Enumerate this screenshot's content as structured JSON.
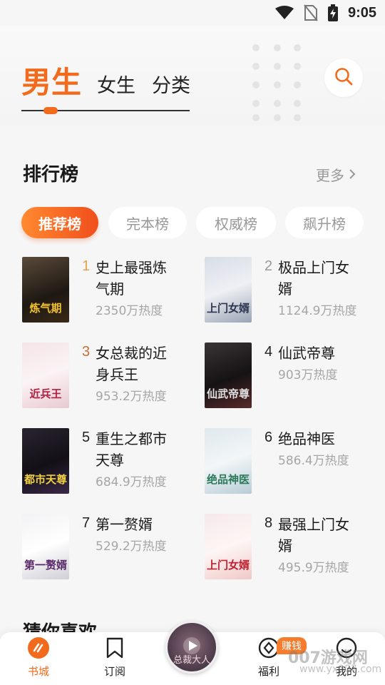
{
  "status_bar": {
    "time": "9:05",
    "icons": [
      "wifi-icon",
      "no-sim-icon",
      "battery-charging-icon"
    ]
  },
  "top_tabs": [
    {
      "label": "男生",
      "active": true
    },
    {
      "label": "女生",
      "active": false
    },
    {
      "label": "分类",
      "active": false
    }
  ],
  "search": {
    "icon": "search-icon"
  },
  "ranking": {
    "title": "排行榜",
    "more": "更多",
    "pills": [
      {
        "label": "推荐榜",
        "active": true
      },
      {
        "label": "完本榜",
        "active": false
      },
      {
        "label": "权威榜",
        "active": false
      },
      {
        "label": "飙升榜",
        "active": false
      }
    ],
    "books": [
      {
        "rank": "1",
        "title": "史上最强炼气期",
        "heat": "2350万热度",
        "cover_text": "炼气期"
      },
      {
        "rank": "2",
        "title": "极品上门女婿",
        "heat": "1124.9万热度",
        "cover_text": "上门女婿"
      },
      {
        "rank": "3",
        "title": "女总裁的近身兵王",
        "heat": "953.2万热度",
        "cover_text": "近兵王"
      },
      {
        "rank": "4",
        "title": "仙武帝尊",
        "heat": "903万热度",
        "cover_text": "仙武帝尊"
      },
      {
        "rank": "5",
        "title": "重生之都市天尊",
        "heat": "684.9万热度",
        "cover_text": "都市天尊"
      },
      {
        "rank": "6",
        "title": "绝品神医",
        "heat": "586.4万热度",
        "cover_text": "绝品神医"
      },
      {
        "rank": "7",
        "title": "第一赘婿",
        "heat": "529.2万热度",
        "cover_text": "第一赘婿"
      },
      {
        "rank": "8",
        "title": "最强上门女婿",
        "heat": "495.9万热度",
        "cover_text": "上门女婿"
      }
    ]
  },
  "guess": {
    "title": "猜你喜欢"
  },
  "bottom_nav": {
    "items": [
      {
        "label": "书城",
        "icon": "bookstore-icon",
        "active": true
      },
      {
        "label": "订阅",
        "icon": "bookmark-icon",
        "active": false
      },
      {
        "label": "福利",
        "icon": "coin-icon",
        "active": false
      },
      {
        "label": "我的",
        "icon": "profile-icon",
        "active": false
      }
    ],
    "earn_badge": "赚钱",
    "player_text": "总裁大人"
  },
  "watermark": {
    "main": "007游戏网",
    "sub": "www.yx007.com"
  },
  "colors": {
    "accent": "#f26a1b",
    "rank_top": "#e3a24a",
    "heat": "#a6a6a6"
  }
}
